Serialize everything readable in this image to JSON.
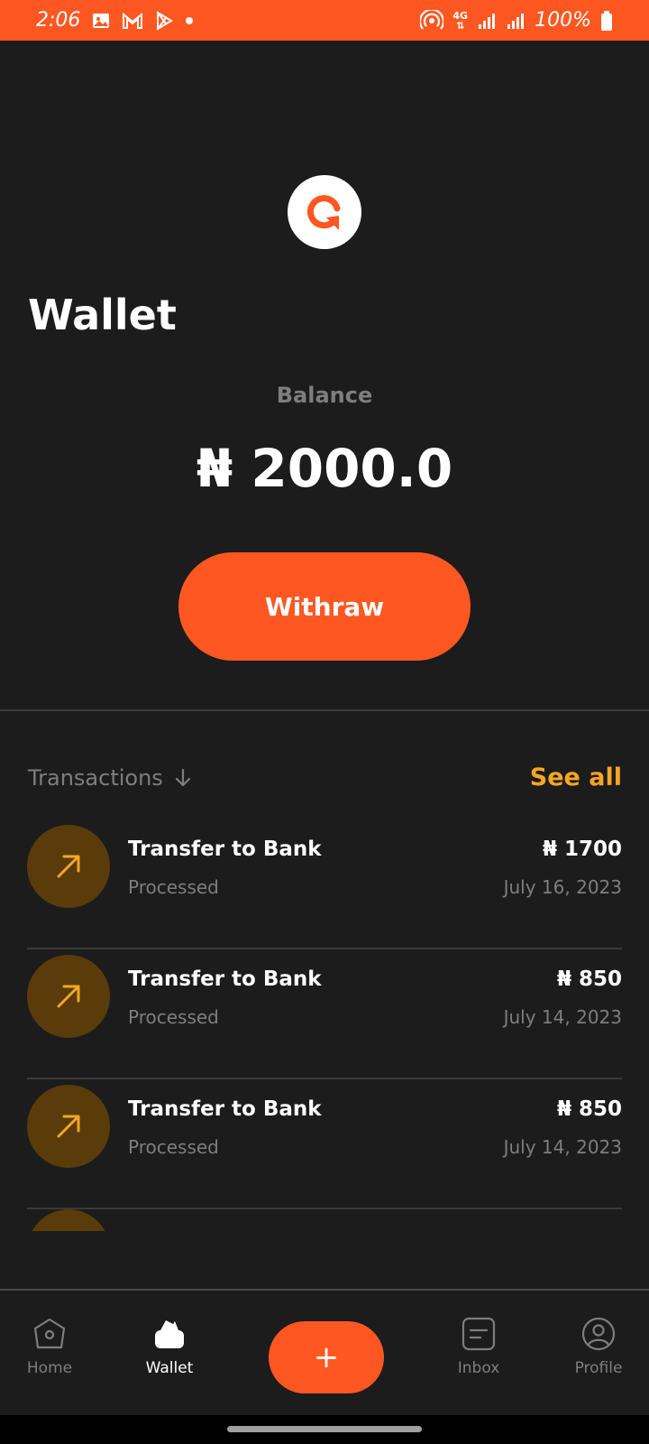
{
  "status_bar": {
    "time": "2:06",
    "battery": "100%",
    "network": "4G"
  },
  "header": {
    "title": "Wallet"
  },
  "balance": {
    "label": "Balance",
    "value": "₦ 2000.0"
  },
  "withdraw_button": {
    "label": "Withraw"
  },
  "transactions": {
    "title": "Transactions",
    "see_all": "See all",
    "items": [
      {
        "name": "Transfer to Bank",
        "status": "Processed",
        "amount": "₦ 1700",
        "date": "July 16, 2023",
        "icon": "arrow-up-right-icon"
      },
      {
        "name": "Transfer to Bank",
        "status": "Processed",
        "amount": "₦ 850",
        "date": "July 14, 2023",
        "icon": "arrow-up-right-icon"
      },
      {
        "name": "Transfer to Bank",
        "status": "Processed",
        "amount": "₦ 850",
        "date": "July 14, 2023",
        "icon": "arrow-up-right-icon"
      }
    ]
  },
  "bottom_nav": {
    "items": [
      {
        "label": "Home",
        "icon": "home-icon",
        "active": false
      },
      {
        "label": "Wallet",
        "icon": "wallet-icon",
        "active": true
      },
      {
        "label": "+",
        "icon": "plus-icon",
        "active": false
      },
      {
        "label": "Inbox",
        "icon": "inbox-icon",
        "active": false
      },
      {
        "label": "Profile",
        "icon": "profile-icon",
        "active": false
      }
    ]
  },
  "colors": {
    "accent": "#ff5722",
    "highlight": "#f5a623",
    "background": "#1c1c1c",
    "muted_text": "#7e7e7e",
    "tx_icon_bg": "#5a3c0a"
  }
}
